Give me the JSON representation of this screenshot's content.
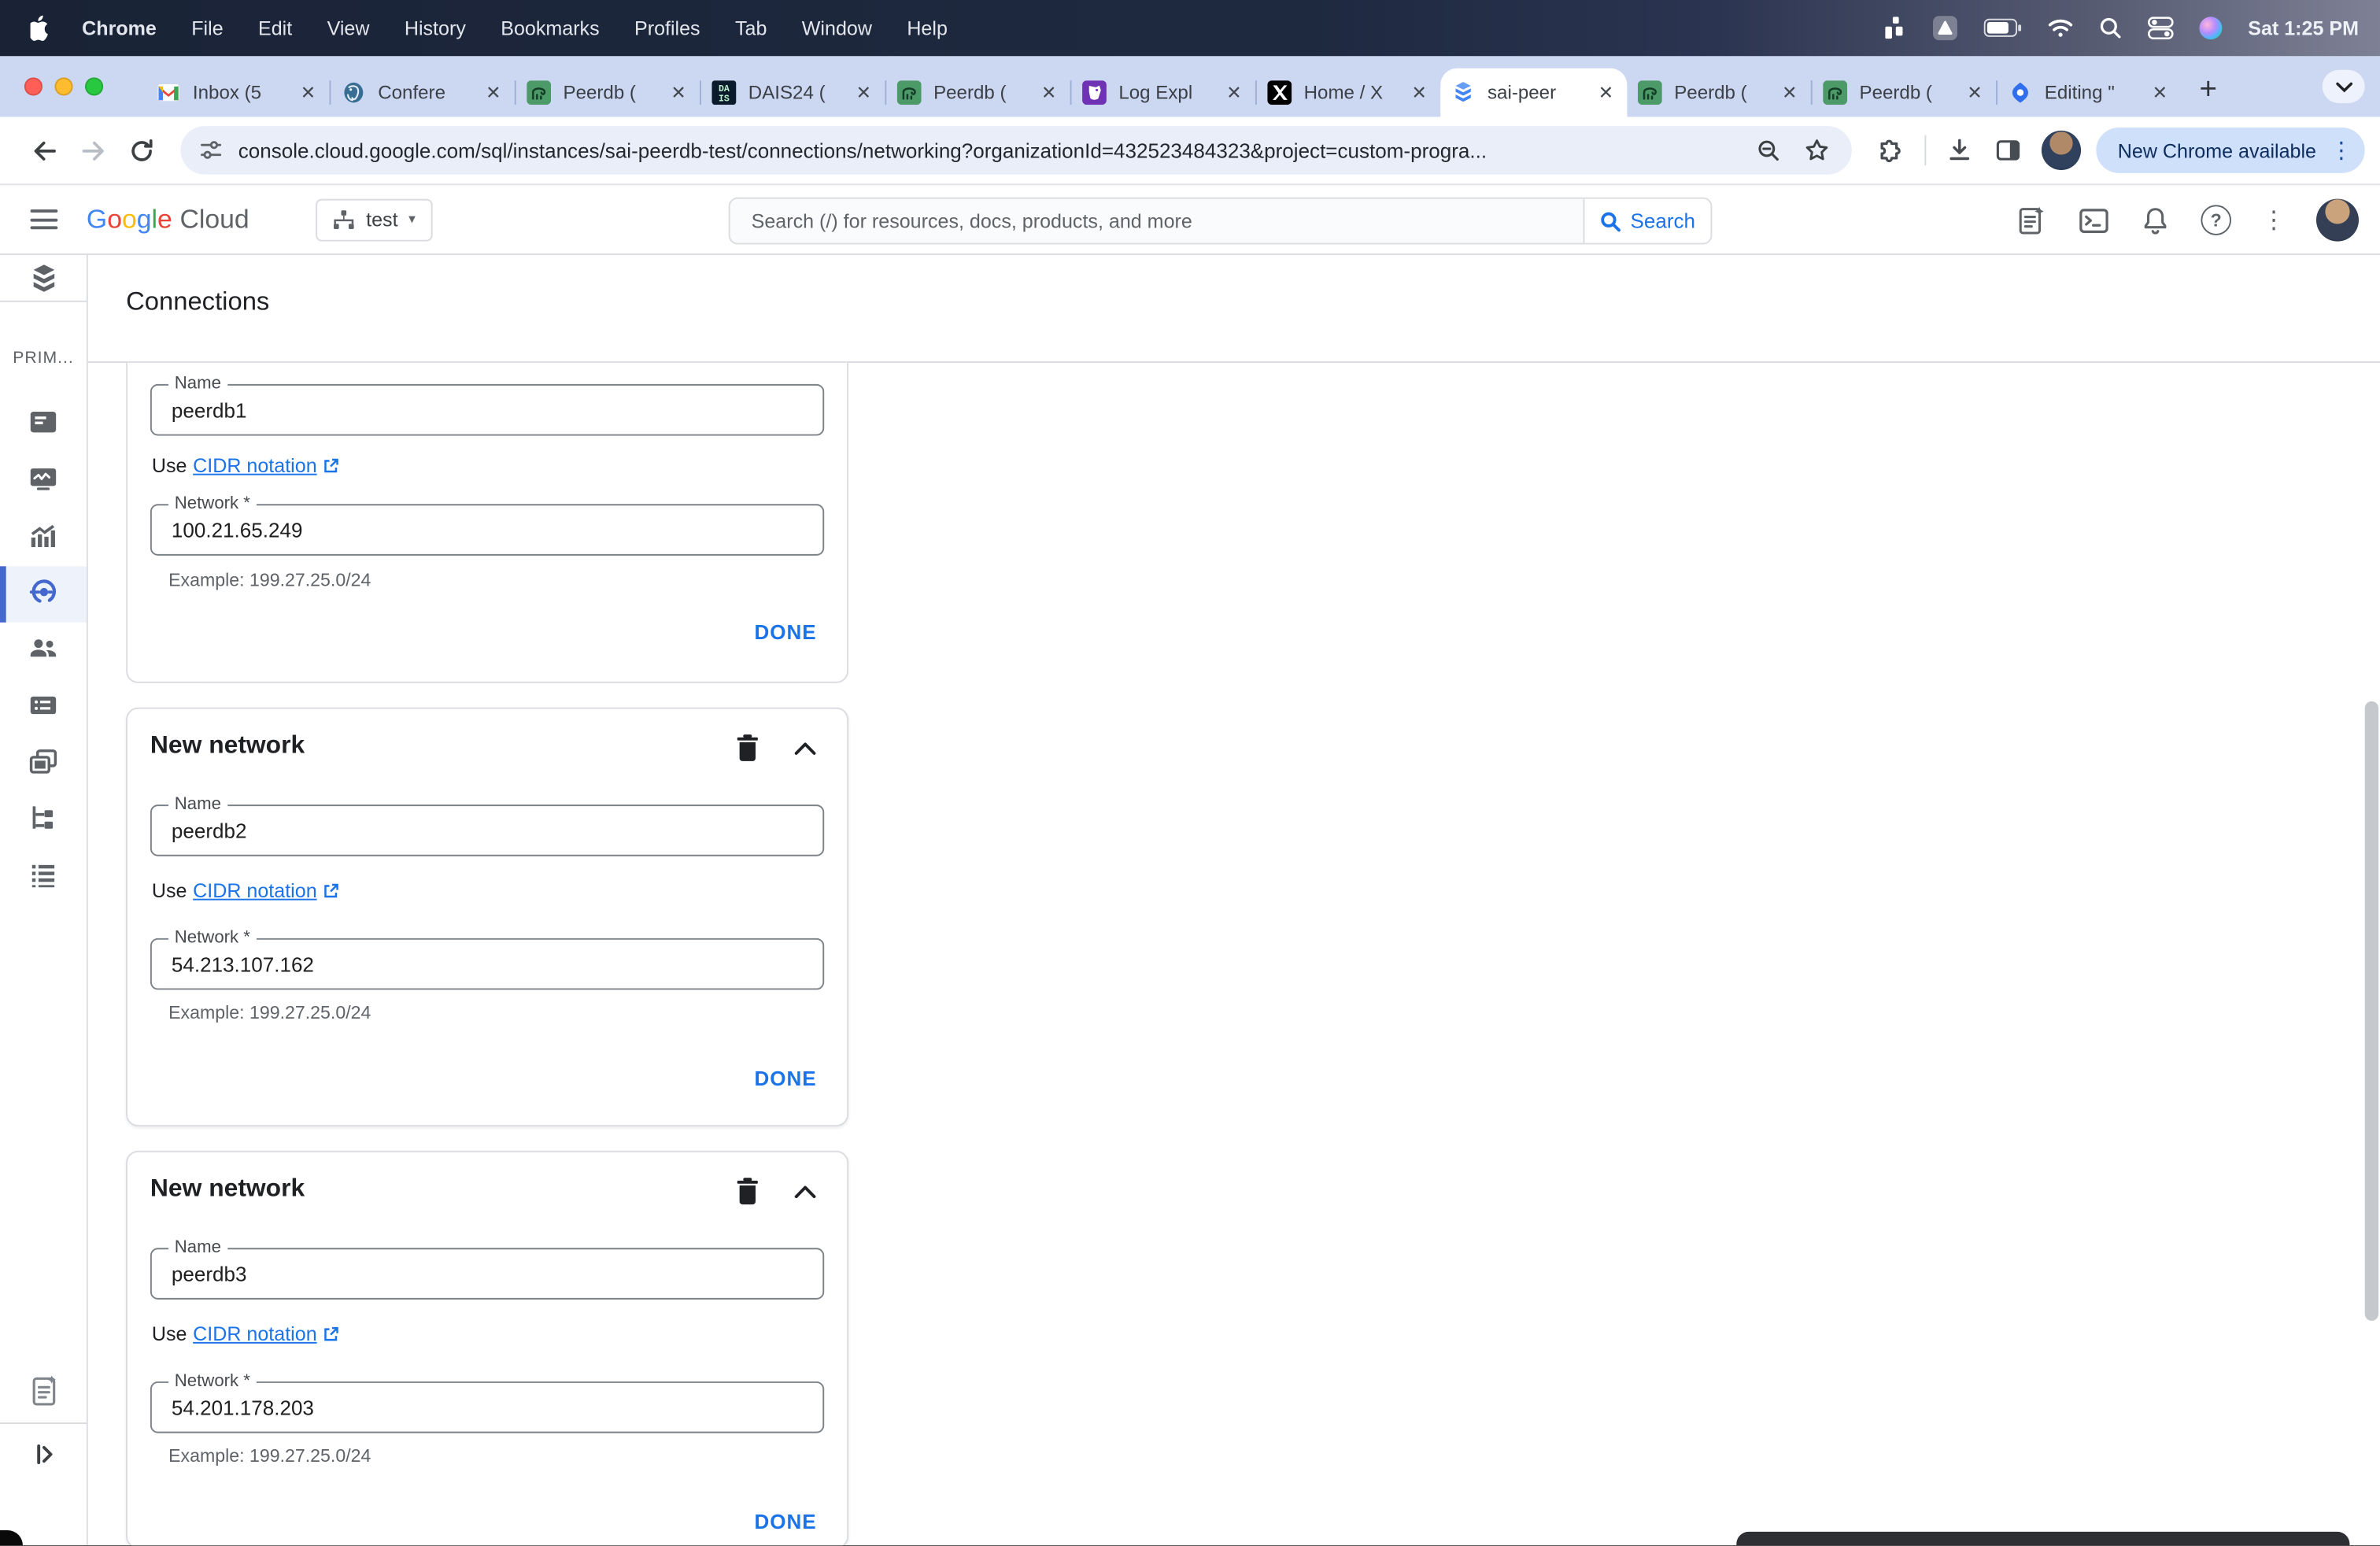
{
  "menubar": {
    "apple_icon": "apple-logo",
    "items": [
      "Chrome",
      "File",
      "Edit",
      "View",
      "History",
      "Bookmarks",
      "Profiles",
      "Tab",
      "Window",
      "Help"
    ],
    "status_icons": [
      "stats-blocks-icon",
      "app-box-icon",
      "battery-icon",
      "wifi-icon",
      "spotlight-icon",
      "control-center-icon",
      "siri-icon"
    ],
    "clock": "Sat 1:25 PM"
  },
  "tabstrip": {
    "tabs": [
      {
        "favicon": "gmail",
        "label": "Inbox (5"
      },
      {
        "favicon": "postgresql",
        "label": "Confere"
      },
      {
        "favicon": "peerdb",
        "label": "Peerdb ("
      },
      {
        "favicon": "dais",
        "label": "DAIS24 ("
      },
      {
        "favicon": "peerdb",
        "label": "Peerdb ("
      },
      {
        "favicon": "datadog",
        "label": "Log Expl"
      },
      {
        "favicon": "x",
        "label": "Home / X"
      },
      {
        "favicon": "cloud-sql",
        "label": "sai-peer",
        "active": true
      },
      {
        "favicon": "peerdb",
        "label": "Peerdb ("
      },
      {
        "favicon": "peerdb",
        "label": "Peerdb ("
      },
      {
        "favicon": "editing",
        "label": "Editing \""
      }
    ],
    "close_glyph": "✕",
    "new_tab": "+"
  },
  "toolbar": {
    "url": "console.cloud.google.com/sql/instances/sai-peerdb-test/connections/networking?organizationId=432523484323&project=custom-progra...",
    "update_pill": "New Chrome available",
    "menu_dots": "⋮"
  },
  "gc_header": {
    "logo_g1": "G",
    "logo_g2": "o",
    "logo_g3": "o",
    "logo_g4": "g",
    "logo_g5": "l",
    "logo_g6": "e",
    "logo_cloud": "Cloud",
    "project": "test",
    "project_caret": "▾",
    "search_placeholder": "Search (/) for resources, docs, products, and more",
    "search_button": "Search",
    "help_glyph": "?",
    "menu_dots": "⋮"
  },
  "sidebar": {
    "section": "PRIM...",
    "items": [
      "overview",
      "system-insights",
      "query-insights",
      "connections",
      "users",
      "databases",
      "backups",
      "replicas",
      "operations"
    ],
    "selected": "connections"
  },
  "content": {
    "title": "Connections",
    "labels": {
      "name": "Name",
      "use": "Use",
      "cidr_link": "CIDR notation",
      "network": "Network *",
      "example": "Example: 199.27.25.0/24",
      "done": "DONE"
    },
    "cards": [
      {
        "name": "peerdb1",
        "network": "100.21.65.249"
      },
      {
        "header": "New network",
        "name": "peerdb2",
        "network": "54.213.107.162"
      },
      {
        "header": "New network",
        "name": "peerdb3",
        "network": "54.201.178.203"
      }
    ]
  },
  "colors": {
    "accent_blue": "#1a73e8",
    "selected_nav_bg": "#eef2fb",
    "tabstrip_bg": "#ccd7f2",
    "menubar_bg": "#1a2336",
    "traffic_red": "#ff5f57",
    "traffic_yellow": "#febc2e",
    "traffic_green": "#28c840"
  }
}
